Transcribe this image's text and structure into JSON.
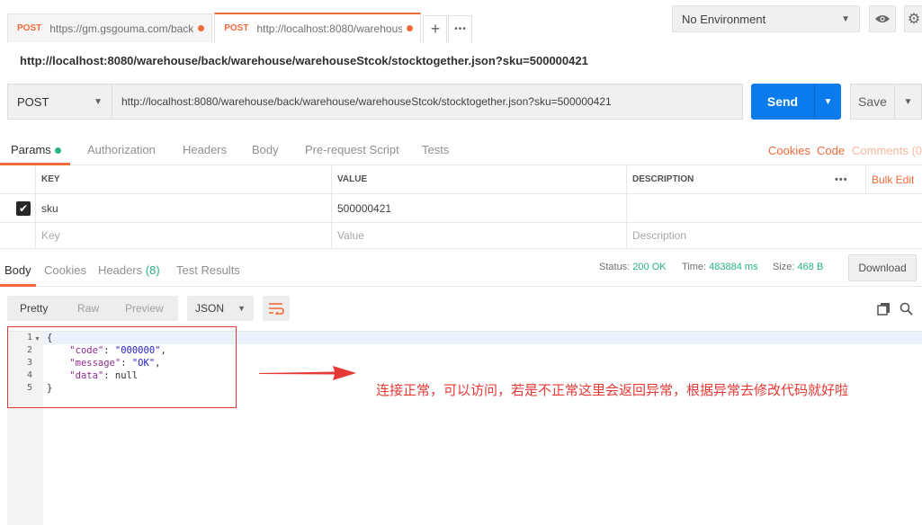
{
  "tabs": [
    {
      "method": "POST",
      "url": "https://gm.gsgouma.com/back/",
      "modified": true,
      "active": false
    },
    {
      "method": "POST",
      "url": "http://localhost:8080/warehous",
      "modified": true,
      "active": true
    }
  ],
  "tab_controls": {
    "add": "+",
    "more": "•••"
  },
  "environment": {
    "selected": "No Environment"
  },
  "request": {
    "title": "http://localhost:8080/warehouse/back/warehouse/warehouseStcok/stocktogether.json?sku=500000421",
    "method": "POST",
    "url": "http://localhost:8080/warehouse/back/warehouse/warehouseStcok/stocktogether.json?sku=500000421",
    "send_label": "Send",
    "save_label": "Save"
  },
  "request_tabs": [
    "Params",
    "Authorization",
    "Headers",
    "Body",
    "Pre-request Script",
    "Tests"
  ],
  "request_links": {
    "cookies": "Cookies",
    "code": "Code",
    "comments": "Comments (0)"
  },
  "params": {
    "headers": {
      "key": "KEY",
      "value": "VALUE",
      "description": "DESCRIPTION",
      "more": "•••",
      "bulk_edit": "Bulk Edit"
    },
    "rows": [
      {
        "checked": true,
        "key": "sku",
        "value": "500000421",
        "description": ""
      }
    ],
    "placeholders": {
      "key": "Key",
      "value": "Value",
      "description": "Description"
    }
  },
  "response_tabs": {
    "body": "Body",
    "cookies": "Cookies",
    "headers": "Headers",
    "headers_count": "(8)",
    "test_results": "Test Results"
  },
  "response_meta": {
    "status_label": "Status:",
    "status": "200 OK",
    "time_label": "Time:",
    "time": "483884 ms",
    "size_label": "Size:",
    "size": "468 B",
    "download": "Download"
  },
  "view_modes": [
    "Pretty",
    "Raw",
    "Preview"
  ],
  "format": "JSON",
  "code_lines": [
    {
      "num": "1",
      "text": "{"
    },
    {
      "num": "2",
      "key": "\"code\"",
      "value": "\"000000\"",
      "tail": ","
    },
    {
      "num": "3",
      "key": "\"message\"",
      "value": "\"OK\"",
      "tail": ","
    },
    {
      "num": "4",
      "key": "\"data\"",
      "value": "null",
      "tail": ""
    },
    {
      "num": "5",
      "text": "}"
    }
  ],
  "annotation": "连接正常，可以访问，若是不正常这里会返回异常，根据异常去修改代码就好啦",
  "colors": {
    "accent": "#f26b3a",
    "send": "#097bed",
    "success": "#26b47f",
    "annotation": "#e53935"
  }
}
